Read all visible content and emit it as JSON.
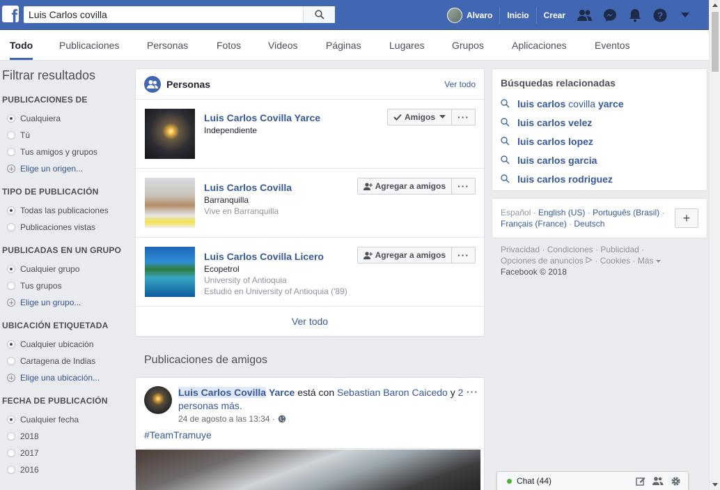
{
  "header": {
    "search_value": "Luis Carlos covilla",
    "user_name": "Alvaro",
    "nav_home": "Inicio",
    "nav_create": "Crear"
  },
  "tabs": [
    "Todo",
    "Publicaciones",
    "Personas",
    "Fotos",
    "Videos",
    "Páginas",
    "Lugares",
    "Grupos",
    "Aplicaciones",
    "Eventos"
  ],
  "sidebar": {
    "title": "Filtrar resultados",
    "sections": [
      {
        "heading": "PUBLICACIONES DE",
        "options": [
          "Cualquiera",
          "Tú",
          "Tus amigos y grupos"
        ],
        "link": "Elige un origen..."
      },
      {
        "heading": "TIPO DE PUBLICACIÓN",
        "options": [
          "Todas las publicaciones",
          "Publicaciones vistas"
        ]
      },
      {
        "heading": "PUBLICADAS EN UN GRUPO",
        "options": [
          "Cualquier grupo",
          "Tus grupos"
        ],
        "link": "Elige un grupo..."
      },
      {
        "heading": "UBICACIÓN ETIQUETADA",
        "options": [
          "Cualquier ubicación",
          "Cartagena de Indias"
        ],
        "link": "Elige una ubicación..."
      },
      {
        "heading": "FECHA DE PUBLICACIÓN",
        "options": [
          "Cualquier fecha",
          "2018",
          "2017",
          "2016"
        ]
      }
    ]
  },
  "people": {
    "title": "Personas",
    "see_all_top": "Ver todo",
    "see_all_bottom": "Ver todo",
    "results": [
      {
        "name": "Luis Carlos Covilla Yarce",
        "lines": [
          "Independiente"
        ],
        "button": "Amigos"
      },
      {
        "name": "Luis Carlos Covilla",
        "lines": [
          "Barranquilla",
          "Vive en Barranquilla"
        ],
        "button": "Agregar a amigos"
      },
      {
        "name": "Luis Carlos Covilla Licero",
        "lines": [
          "Ecopetrol",
          "University of Antioquia",
          "Estudió en University of Antioquia ('89)"
        ],
        "button": "Agregar a amigos"
      }
    ]
  },
  "friends_posts": {
    "title": "Publicaciones de amigos",
    "post": {
      "author_highlight": "Luis Carlos Covilla",
      "author_rest": "Yarce",
      "with_text": "está con",
      "with_name": "Sebastian Baron Caicedo",
      "and_text": "y",
      "others": "2 personas más.",
      "date": "24 de agosto a las 13:34 ·",
      "text": "#TeamTramuye"
    }
  },
  "related": {
    "title": "Búsquedas relacionadas",
    "items": [
      {
        "bold": "luis carlos",
        "normal": " covilla ",
        "bold2": "yarce"
      },
      {
        "bold": "luis carlos velez",
        "normal": "",
        "bold2": ""
      },
      {
        "bold": "luis carlos lopez",
        "normal": "",
        "bold2": ""
      },
      {
        "bold": "luis carlos garcia",
        "normal": "",
        "bold2": ""
      },
      {
        "bold": "luis carlos rodriguez",
        "normal": "",
        "bold2": ""
      }
    ]
  },
  "languages": {
    "current": "Español",
    "links": [
      "English (US)",
      "Português (Brasil)",
      "Français (France)",
      "Deutsch"
    ],
    "add": "+"
  },
  "footer": {
    "links": [
      "Privacidad",
      "Condiciones",
      "Publicidad",
      "Opciones de anuncios",
      "Cookies",
      "Más"
    ],
    "copyright": "Facebook © 2018"
  },
  "chat": {
    "label": "Chat (44)"
  },
  "colors": {
    "brand": "#4267b2",
    "link": "#365899",
    "online": "#42b72a"
  }
}
